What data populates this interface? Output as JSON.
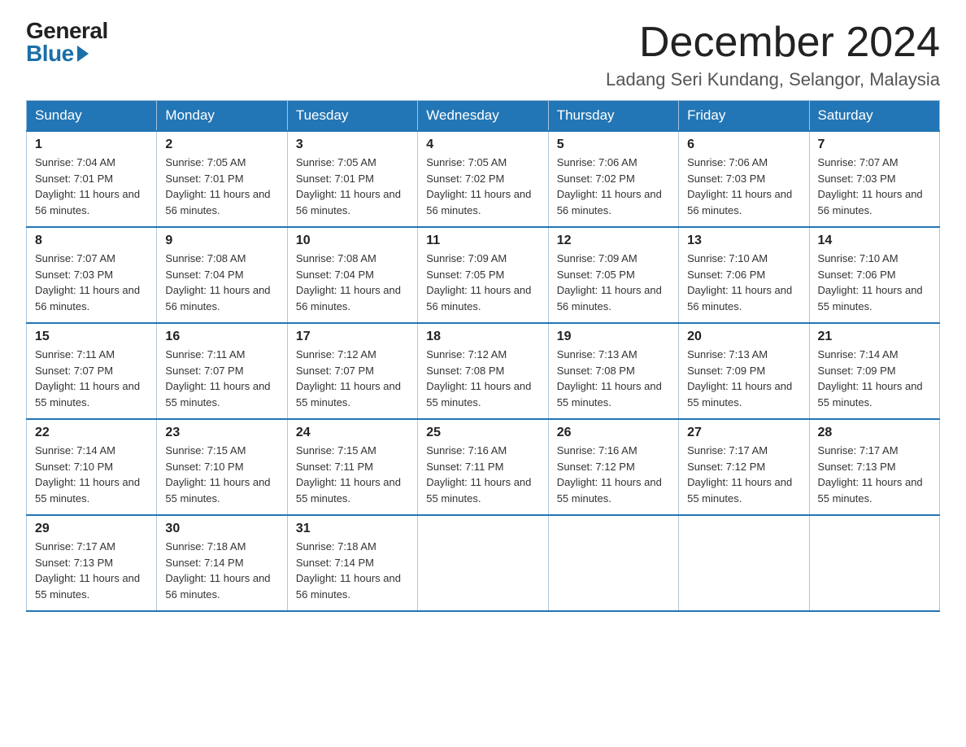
{
  "logo": {
    "general": "General",
    "blue": "Blue"
  },
  "header": {
    "month": "December 2024",
    "location": "Ladang Seri Kundang, Selangor, Malaysia"
  },
  "weekdays": [
    "Sunday",
    "Monday",
    "Tuesday",
    "Wednesday",
    "Thursday",
    "Friday",
    "Saturday"
  ],
  "weeks": [
    [
      {
        "day": "1",
        "sunrise": "7:04 AM",
        "sunset": "7:01 PM",
        "daylight": "11 hours and 56 minutes."
      },
      {
        "day": "2",
        "sunrise": "7:05 AM",
        "sunset": "7:01 PM",
        "daylight": "11 hours and 56 minutes."
      },
      {
        "day": "3",
        "sunrise": "7:05 AM",
        "sunset": "7:01 PM",
        "daylight": "11 hours and 56 minutes."
      },
      {
        "day": "4",
        "sunrise": "7:05 AM",
        "sunset": "7:02 PM",
        "daylight": "11 hours and 56 minutes."
      },
      {
        "day": "5",
        "sunrise": "7:06 AM",
        "sunset": "7:02 PM",
        "daylight": "11 hours and 56 minutes."
      },
      {
        "day": "6",
        "sunrise": "7:06 AM",
        "sunset": "7:03 PM",
        "daylight": "11 hours and 56 minutes."
      },
      {
        "day": "7",
        "sunrise": "7:07 AM",
        "sunset": "7:03 PM",
        "daylight": "11 hours and 56 minutes."
      }
    ],
    [
      {
        "day": "8",
        "sunrise": "7:07 AM",
        "sunset": "7:03 PM",
        "daylight": "11 hours and 56 minutes."
      },
      {
        "day": "9",
        "sunrise": "7:08 AM",
        "sunset": "7:04 PM",
        "daylight": "11 hours and 56 minutes."
      },
      {
        "day": "10",
        "sunrise": "7:08 AM",
        "sunset": "7:04 PM",
        "daylight": "11 hours and 56 minutes."
      },
      {
        "day": "11",
        "sunrise": "7:09 AM",
        "sunset": "7:05 PM",
        "daylight": "11 hours and 56 minutes."
      },
      {
        "day": "12",
        "sunrise": "7:09 AM",
        "sunset": "7:05 PM",
        "daylight": "11 hours and 56 minutes."
      },
      {
        "day": "13",
        "sunrise": "7:10 AM",
        "sunset": "7:06 PM",
        "daylight": "11 hours and 56 minutes."
      },
      {
        "day": "14",
        "sunrise": "7:10 AM",
        "sunset": "7:06 PM",
        "daylight": "11 hours and 55 minutes."
      }
    ],
    [
      {
        "day": "15",
        "sunrise": "7:11 AM",
        "sunset": "7:07 PM",
        "daylight": "11 hours and 55 minutes."
      },
      {
        "day": "16",
        "sunrise": "7:11 AM",
        "sunset": "7:07 PM",
        "daylight": "11 hours and 55 minutes."
      },
      {
        "day": "17",
        "sunrise": "7:12 AM",
        "sunset": "7:07 PM",
        "daylight": "11 hours and 55 minutes."
      },
      {
        "day": "18",
        "sunrise": "7:12 AM",
        "sunset": "7:08 PM",
        "daylight": "11 hours and 55 minutes."
      },
      {
        "day": "19",
        "sunrise": "7:13 AM",
        "sunset": "7:08 PM",
        "daylight": "11 hours and 55 minutes."
      },
      {
        "day": "20",
        "sunrise": "7:13 AM",
        "sunset": "7:09 PM",
        "daylight": "11 hours and 55 minutes."
      },
      {
        "day": "21",
        "sunrise": "7:14 AM",
        "sunset": "7:09 PM",
        "daylight": "11 hours and 55 minutes."
      }
    ],
    [
      {
        "day": "22",
        "sunrise": "7:14 AM",
        "sunset": "7:10 PM",
        "daylight": "11 hours and 55 minutes."
      },
      {
        "day": "23",
        "sunrise": "7:15 AM",
        "sunset": "7:10 PM",
        "daylight": "11 hours and 55 minutes."
      },
      {
        "day": "24",
        "sunrise": "7:15 AM",
        "sunset": "7:11 PM",
        "daylight": "11 hours and 55 minutes."
      },
      {
        "day": "25",
        "sunrise": "7:16 AM",
        "sunset": "7:11 PM",
        "daylight": "11 hours and 55 minutes."
      },
      {
        "day": "26",
        "sunrise": "7:16 AM",
        "sunset": "7:12 PM",
        "daylight": "11 hours and 55 minutes."
      },
      {
        "day": "27",
        "sunrise": "7:17 AM",
        "sunset": "7:12 PM",
        "daylight": "11 hours and 55 minutes."
      },
      {
        "day": "28",
        "sunrise": "7:17 AM",
        "sunset": "7:13 PM",
        "daylight": "11 hours and 55 minutes."
      }
    ],
    [
      {
        "day": "29",
        "sunrise": "7:17 AM",
        "sunset": "7:13 PM",
        "daylight": "11 hours and 55 minutes."
      },
      {
        "day": "30",
        "sunrise": "7:18 AM",
        "sunset": "7:14 PM",
        "daylight": "11 hours and 56 minutes."
      },
      {
        "day": "31",
        "sunrise": "7:18 AM",
        "sunset": "7:14 PM",
        "daylight": "11 hours and 56 minutes."
      },
      null,
      null,
      null,
      null
    ]
  ]
}
